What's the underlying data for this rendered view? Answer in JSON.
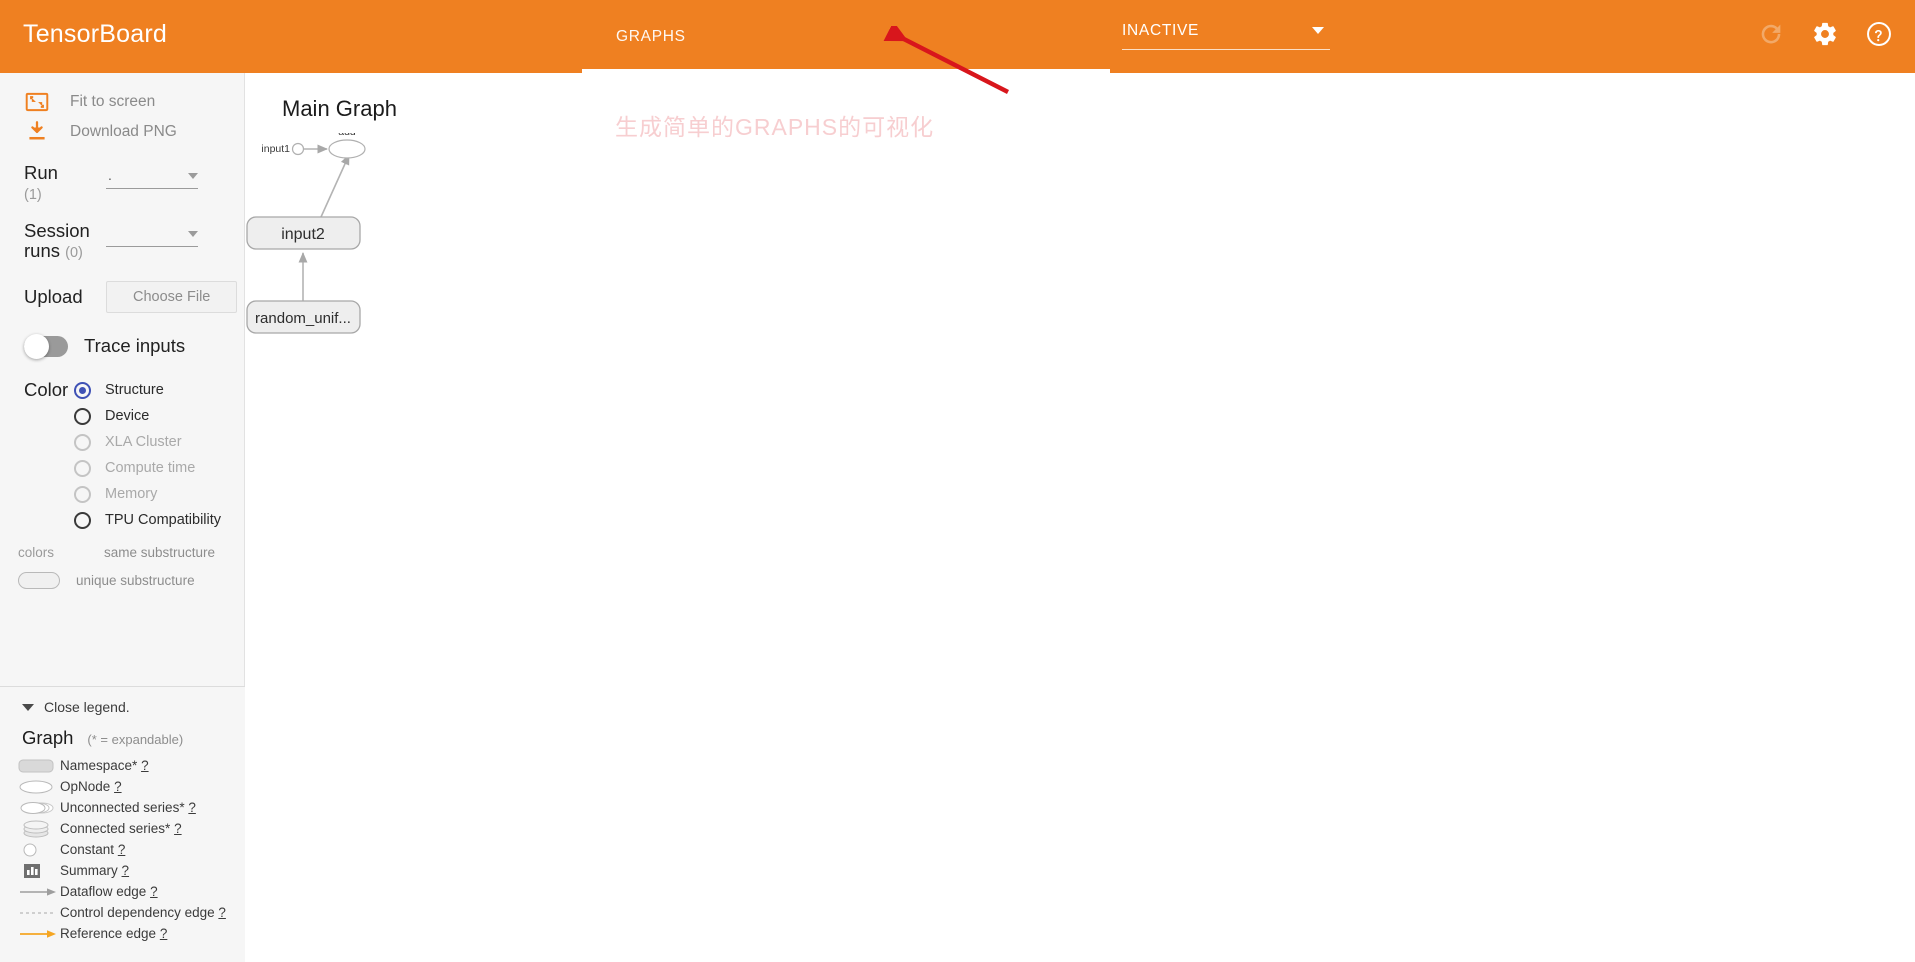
{
  "app": {
    "brand": "TensorBoard",
    "accent": "#ef8021"
  },
  "topbar": {
    "tabs": [
      {
        "label": "GRAPHS",
        "active": true
      }
    ],
    "dashboard_select": {
      "value": "INACTIVE",
      "caret": "chevron-down-icon"
    },
    "icons": [
      {
        "name": "refresh-icon",
        "state": "dimmed"
      },
      {
        "name": "gear-icon",
        "state": "enabled"
      },
      {
        "name": "help-icon",
        "state": "enabled"
      }
    ]
  },
  "annotations": {
    "arrow": {
      "color": "#d8161c",
      "points_to": "GRAPHS"
    },
    "chinese_note": {
      "text": "生成简单的GRAPHS的可视化",
      "color": "#f7ced0"
    }
  },
  "sidebar": {
    "actions": [
      {
        "icon": "fit-to-screen-icon",
        "label": "Fit to screen"
      },
      {
        "icon": "download-png-icon",
        "label": "Download PNG"
      }
    ],
    "run": {
      "label": "Run",
      "count": "(1)",
      "value": "."
    },
    "session_runs": {
      "label": "Session runs",
      "count": "(0)",
      "value": ""
    },
    "upload": {
      "label": "Upload",
      "button": "Choose File"
    },
    "trace_inputs": {
      "label": "Trace inputs",
      "on": false
    },
    "color": {
      "label": "Color",
      "options": [
        {
          "label": "Structure",
          "selected": true,
          "disabled": false
        },
        {
          "label": "Device",
          "selected": false,
          "disabled": false
        },
        {
          "label": "XLA Cluster",
          "selected": false,
          "disabled": true
        },
        {
          "label": "Compute time",
          "selected": false,
          "disabled": true
        },
        {
          "label": "Memory",
          "selected": false,
          "disabled": true
        },
        {
          "label": "TPU Compatibility",
          "selected": false,
          "disabled": false
        }
      ],
      "substructure": {
        "key": "colors",
        "same": "same substructure",
        "unique": "unique substructure"
      }
    }
  },
  "legend": {
    "close_label": "Close legend.",
    "title": "Graph",
    "subtitle": "(* = expandable)",
    "items": [
      {
        "icon": "namespace-icon",
        "label": "Namespace*",
        "help": "?"
      },
      {
        "icon": "opnode-icon",
        "label": "OpNode",
        "help": "?"
      },
      {
        "icon": "unconnected-series-icon",
        "label": "Unconnected series*",
        "help": "?"
      },
      {
        "icon": "connected-series-icon",
        "label": "Connected series*",
        "help": "?"
      },
      {
        "icon": "constant-icon",
        "label": "Constant",
        "help": "?"
      },
      {
        "icon": "summary-icon",
        "label": "Summary",
        "help": "?"
      },
      {
        "icon": "dataflow-edge-icon",
        "label": "Dataflow edge",
        "help": "?"
      },
      {
        "icon": "control-dependency-edge-icon",
        "label": "Control dependency edge",
        "help": "?"
      },
      {
        "icon": "reference-edge-icon",
        "label": "Reference edge",
        "help": "?"
      }
    ]
  },
  "main": {
    "title": "Main Graph",
    "graph": {
      "nodes": [
        {
          "id": "input1",
          "label": "input1",
          "shape": "constant"
        },
        {
          "id": "add",
          "label": "add",
          "shape": "opnode"
        },
        {
          "id": "input2",
          "label": "input2",
          "shape": "namespace"
        },
        {
          "id": "random_uniform",
          "label": "random_unif...",
          "shape": "namespace"
        }
      ],
      "edges": [
        {
          "from": "input1",
          "to": "add"
        },
        {
          "from": "input2",
          "to": "add"
        },
        {
          "from": "random_uniform",
          "to": "input2"
        }
      ]
    }
  }
}
